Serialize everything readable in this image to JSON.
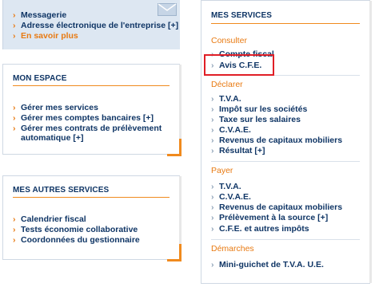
{
  "top_links": [
    "Messagerie",
    "Adresse électronique de l'entreprise [+]",
    "En savoir plus"
  ],
  "mon_espace": {
    "title": "MON ESPACE",
    "items": [
      "Gérer mes services",
      "Gérer mes comptes bancaires [+]",
      "Gérer mes contrats de prélèvement",
      "automatique [+]"
    ]
  },
  "mes_autres_services": {
    "title": "MES AUTRES SERVICES",
    "items": [
      "Calendrier fiscal",
      "Tests économie collaborative",
      "Coordonnées du gestionnaire"
    ]
  },
  "mes_services": {
    "title": "MES SERVICES",
    "consulter": {
      "heading": "Consulter",
      "items": [
        "Compte fiscal",
        "Avis C.F.E."
      ]
    },
    "declarer": {
      "heading": "Déclarer",
      "items": [
        "T.V.A.",
        "Impôt sur les sociétés",
        "Taxe sur les salaires",
        "C.V.A.E.",
        "Revenus de capitaux mobiliers",
        "Résultat [+]"
      ]
    },
    "payer": {
      "heading": "Payer",
      "items": [
        "T.V.A.",
        "C.V.A.E.",
        "Revenus de capitaux mobiliers",
        "Prélèvement à la source [+]",
        "C.F.E. et autres impôts"
      ]
    },
    "demarches": {
      "heading": "Démarches",
      "items": [
        "Mini-guichet de T.V.A. U.E."
      ]
    }
  },
  "colors": {
    "navy": "#0f3565",
    "orange": "#e87a12",
    "highlight": "#e01e26",
    "light_blue": "#dde7f2"
  },
  "icons": {
    "bullet": "chevron-right-icon",
    "mail": "envelope-icon"
  }
}
